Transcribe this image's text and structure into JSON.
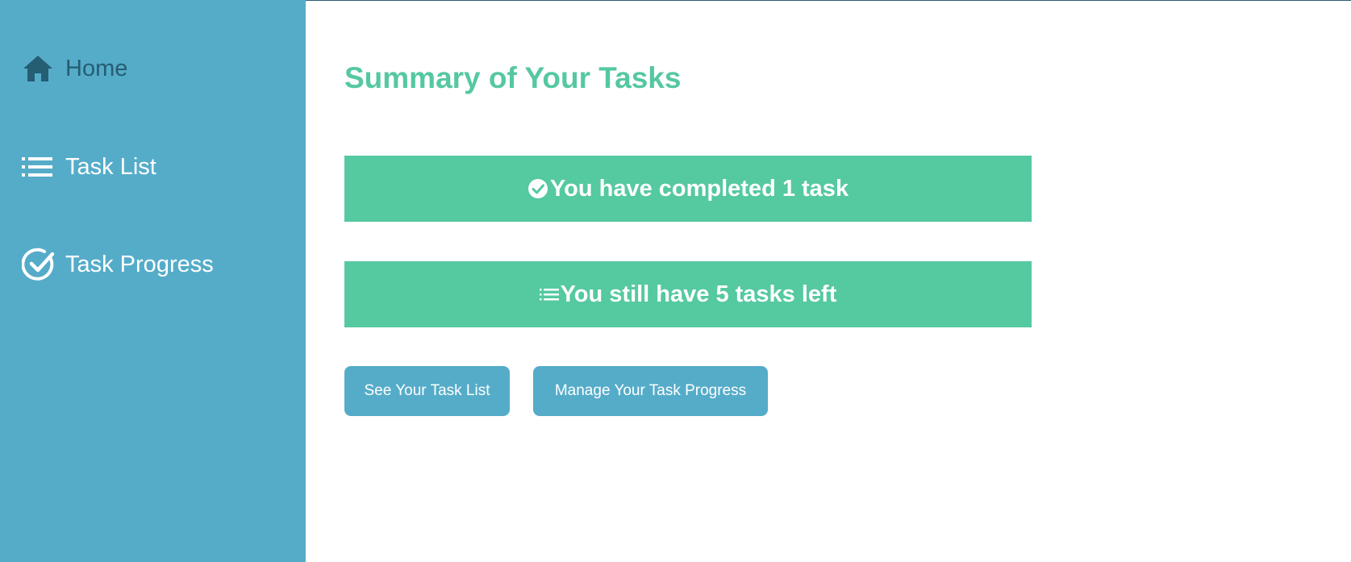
{
  "sidebar": {
    "items": [
      {
        "label": "Home",
        "icon": "home-icon",
        "active": true
      },
      {
        "label": "Task List",
        "icon": "list-icon",
        "active": false
      },
      {
        "label": "Task Progress",
        "icon": "check-circle-icon",
        "active": false
      }
    ]
  },
  "main": {
    "title": "Summary of Your Tasks",
    "completed_text": "You have completed 1 task",
    "remaining_text": "You still have 5 tasks left",
    "buttons": {
      "task_list": "See Your Task List",
      "task_progress": "Manage Your Task Progress"
    }
  },
  "colors": {
    "sidebar_bg": "#55acc9",
    "accent_green": "#55c9a0",
    "active_nav_text": "#255d72",
    "button_bg": "#55acc9"
  }
}
